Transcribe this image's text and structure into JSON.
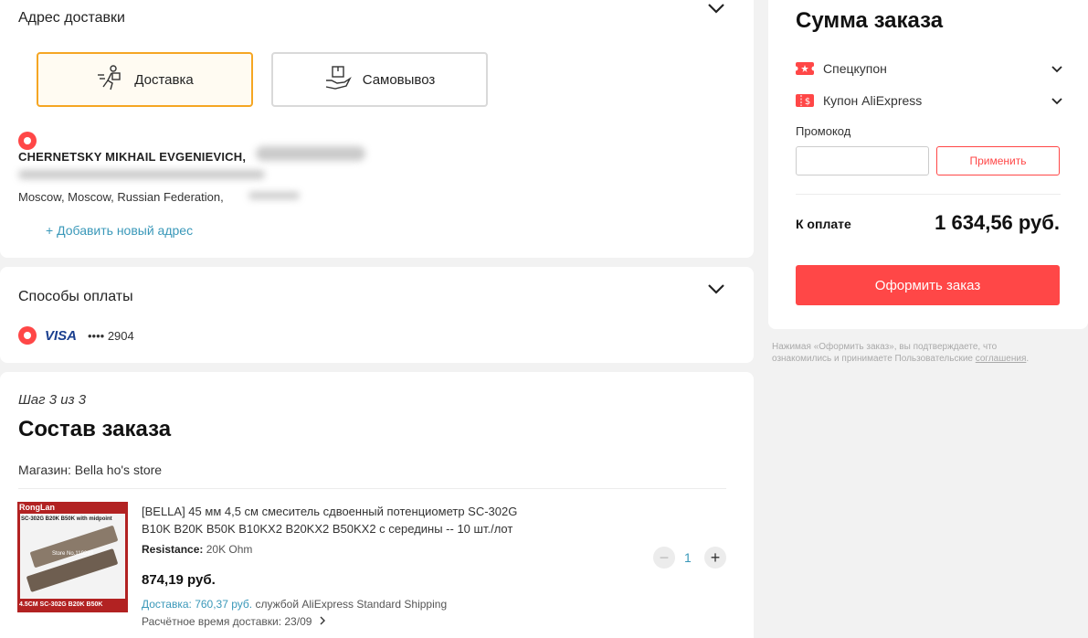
{
  "delivery": {
    "title": "Адрес доставки",
    "option_delivery": "Доставка",
    "option_pickup": "Самовывоз",
    "recipient_name": "CHERNETSKY MIKHAIL EVGENIEVICH,",
    "address": "Moscow, Moscow, Russian Federation,",
    "add_address": "+ Добавить новый адрес"
  },
  "payment": {
    "title": "Способы оплаты",
    "card_brand": "VISA",
    "card_mask": "•••• 2904"
  },
  "order": {
    "step": "Шаг 3 из 3",
    "title": "Состав заказа",
    "store": "Магазин: Bella ho's store",
    "item": {
      "image_brand": "RongLan",
      "image_top_text": "SC-302G B20K B50K with midpoint",
      "image_store_text": "Store No.119293",
      "image_bottom_text": "4.5CM SC-302G B20K B50K",
      "title_line1": "[BELLA] 45 мм 4,5 см смеситель сдвоенный потенциометр SC-302G",
      "title_line2": "B10K B20K B50K B10KX2 B20KX2 B50KX2 с середины -- 10 шт./лот",
      "attr_name": "Resistance:",
      "attr_value": "20K Ohm",
      "price": "874,19 руб.",
      "shipping_cost": "Доставка: 760,37 руб.",
      "shipping_service": "службой AliExpress Standard Shipping",
      "eta": "Расчётное время доставки: 23/09",
      "quantity": "1",
      "qty_minus": "−",
      "qty_plus": "+"
    }
  },
  "summary": {
    "title": "Сумма заказа",
    "special_coupon": "Спецкупон",
    "ali_coupon": "Купон AliExpress",
    "promo_label": "Промокод",
    "promo_placeholder": "",
    "apply": "Применить",
    "total_label": "К оплате",
    "total_value": "1 634,56 руб.",
    "checkout": "Оформить заказ",
    "disclaimer_line1": "Нажимая «Оформить заказ», вы подтверждаете, что",
    "disclaimer_line2": "ознакомились и принимаете Пользовательские",
    "disclaimer_link": "соглашения",
    "disclaimer_end": "."
  },
  "colors": {
    "accent": "#ff4747",
    "selected_border": "#f5a623",
    "link": "#3a98b9",
    "visa": "#1a3f8f"
  }
}
